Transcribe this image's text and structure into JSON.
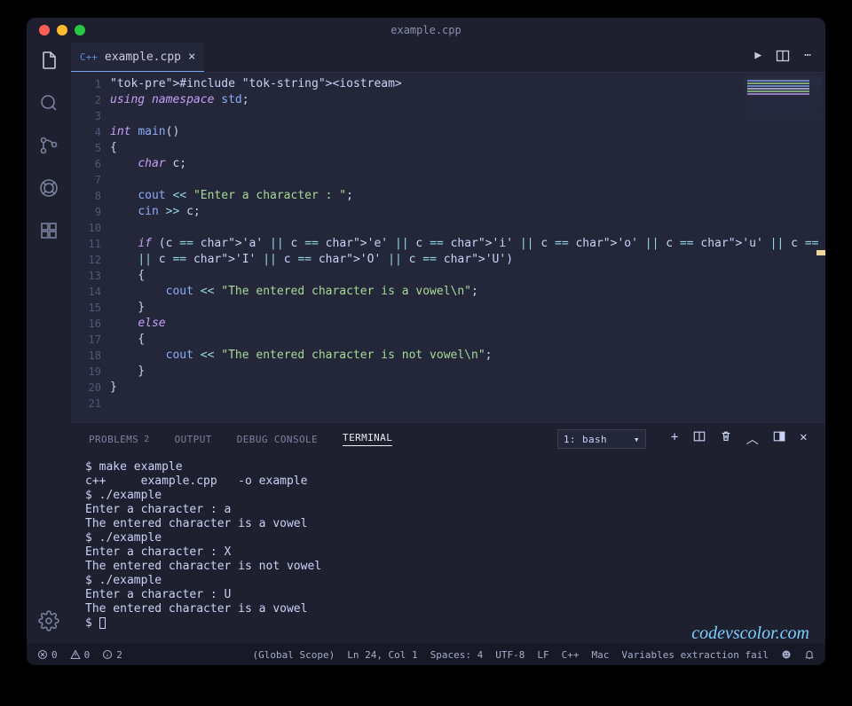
{
  "window": {
    "title": "example.cpp"
  },
  "tab": {
    "icon_label": "C++",
    "label": "example.cpp"
  },
  "code": {
    "lines": [
      "#include <iostream>",
      "using namespace std;",
      "",
      "int main()",
      "{",
      "    char c;",
      "",
      "    cout << \"Enter a character : \";",
      "    cin >> c;",
      "",
      "    if (c == 'a' || c == 'e' || c == 'i' || c == 'o' || c == 'u' || c == 'A' || c == 'E'",
      "    || c == 'I' || c == 'O' || c == 'U')",
      "    {",
      "        cout << \"The entered character is a vowel\\n\";",
      "    }",
      "    else",
      "    {",
      "        cout << \"The entered character is not vowel\\n\";",
      "    }",
      "}",
      ""
    ]
  },
  "panel": {
    "tabs": {
      "problems": "PROBLEMS",
      "problems_badge": "2",
      "output": "OUTPUT",
      "debug": "DEBUG CONSOLE",
      "terminal": "TERMINAL"
    },
    "terminal_select": "1: bash"
  },
  "terminal": {
    "lines": [
      "$ make example",
      "c++     example.cpp   -o example",
      "$ ./example",
      "Enter a character : a",
      "The entered character is a vowel",
      "$ ./example",
      "Enter a character : X",
      "The entered character is not vowel",
      "$ ./example",
      "Enter a character : U",
      "The entered character is a vowel",
      "$ "
    ]
  },
  "watermark": "codevscolor.com",
  "status": {
    "errors": "0",
    "warnings": "0",
    "info": "2",
    "scope": "(Global Scope)",
    "cursor": "Ln 24, Col 1",
    "spaces": "Spaces: 4",
    "encoding": "UTF-8",
    "eol": "LF",
    "lang": "C++",
    "os": "Mac",
    "msg": "Variables extraction fail"
  },
  "icons": {
    "run": "▶",
    "split": "▭",
    "more": "⋯",
    "plus": "+",
    "trash": "🗑",
    "chevron_up": "︿",
    "maximize": "▢",
    "close_panel": "✕"
  }
}
